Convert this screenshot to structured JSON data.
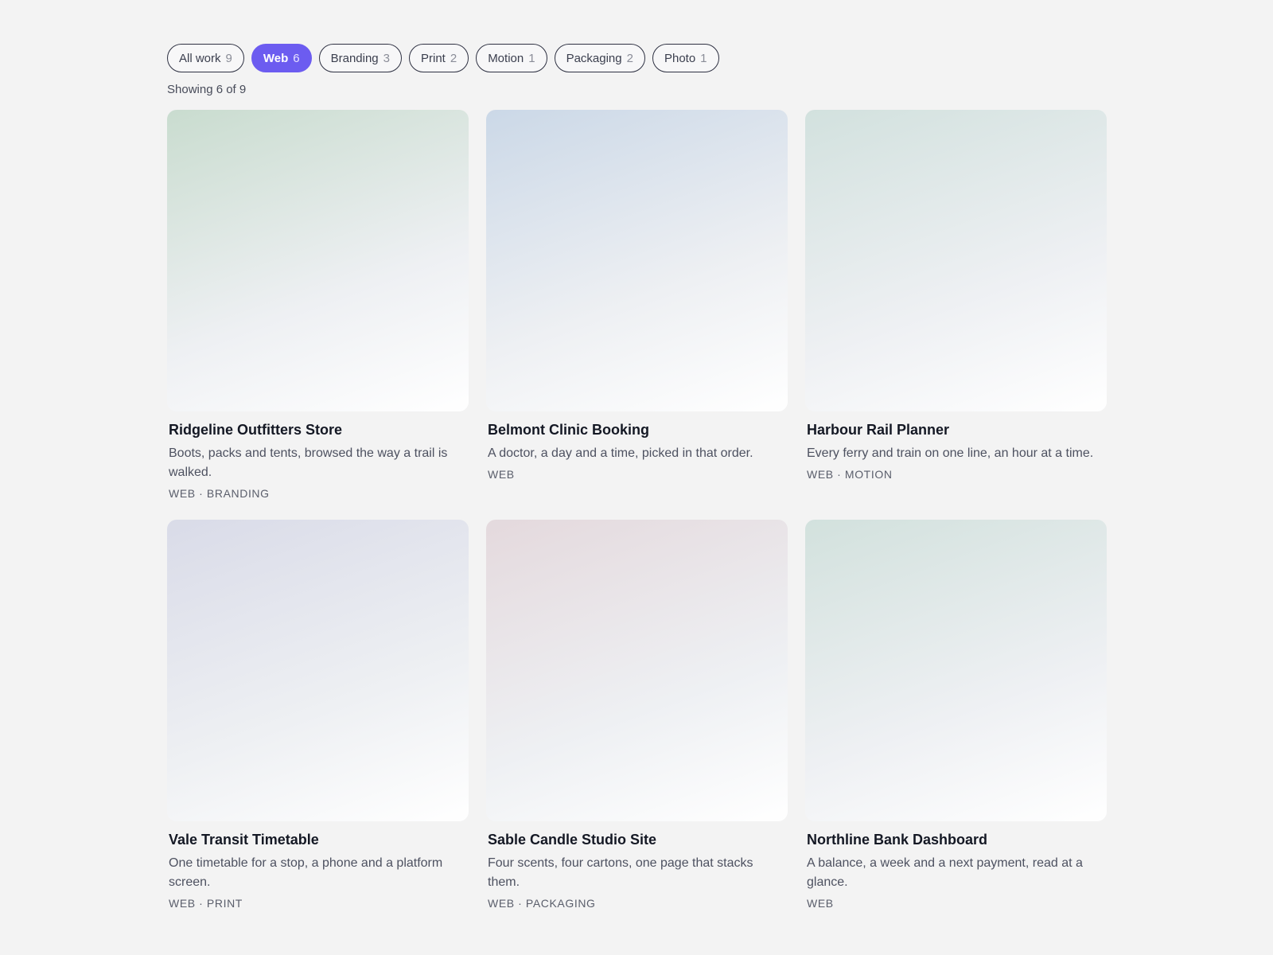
{
  "filters": [
    {
      "label": "All work",
      "count": "9",
      "active": false
    },
    {
      "label": "Web",
      "count": "6",
      "active": true
    },
    {
      "label": "Branding",
      "count": "3",
      "active": false
    },
    {
      "label": "Print",
      "count": "2",
      "active": false
    },
    {
      "label": "Motion",
      "count": "1",
      "active": false
    },
    {
      "label": "Packaging",
      "count": "2",
      "active": false
    },
    {
      "label": "Photo",
      "count": "1",
      "active": false
    }
  ],
  "showing": "Showing 6 of 9",
  "projects": [
    {
      "title": "Ridgeline Outfitters Store",
      "description": "Boots, packs and tents, browsed the way a trail is walked.",
      "tags": "WEB · BRANDING",
      "tint": "#c9dccf"
    },
    {
      "title": "Belmont Clinic Booking",
      "description": "A doctor, a day and a time, picked in that order.",
      "tags": "WEB",
      "tint": "#cbd8e7"
    },
    {
      "title": "Harbour Rail Planner",
      "description": "Every ferry and train on one line, an hour at a time.",
      "tags": "WEB · MOTION",
      "tint": "#d2e1de"
    },
    {
      "title": "Vale Transit Timetable",
      "description": "One timetable for a stop, a phone and a platform screen.",
      "tags": "WEB · PRINT",
      "tint": "#d9dbe8"
    },
    {
      "title": "Sable Candle Studio Site",
      "description": "Four scents, four cartons, one page that stacks them.",
      "tags": "WEB · PACKAGING",
      "tint": "#e4d9dd"
    },
    {
      "title": "Northline Bank Dashboard",
      "description": "A balance, a week and a next payment, read at a glance.",
      "tags": "WEB",
      "tint": "#d2e1dd"
    }
  ]
}
